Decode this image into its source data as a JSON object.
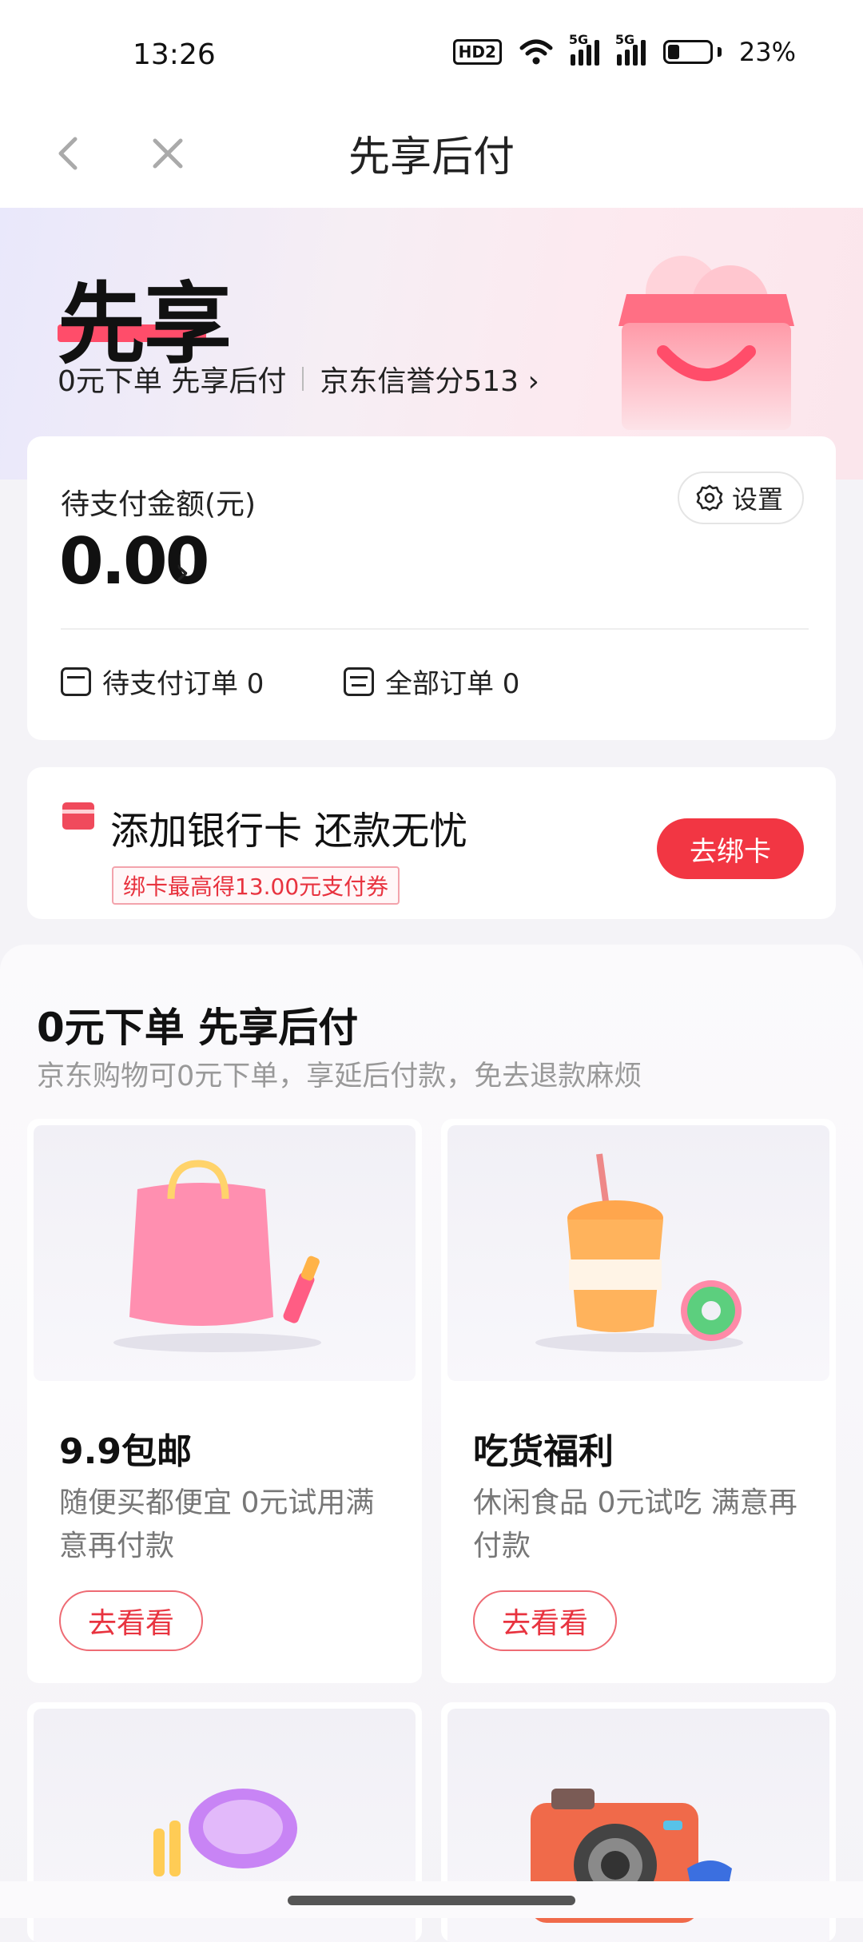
{
  "status_bar": {
    "time": "13:26",
    "hd_label": "HD2",
    "network_1": "5G",
    "network_2": "5G",
    "battery": "23%",
    "battery_level": 0.23
  },
  "nav": {
    "title": "先享后付"
  },
  "hero": {
    "title": "先享",
    "tagline": "0元下单 先享后付",
    "credit_score": "京东信誉分513",
    "credit_arrow": "›"
  },
  "pay_card": {
    "label": "待支付金额(元)",
    "amount": "0.00",
    "amount_arrow": "›",
    "settings_label": "设置",
    "pending_orders": "待支付订单 0",
    "all_orders": "全部订单 0"
  },
  "bank_card": {
    "title": "添加银行卡 还款无忧",
    "coupon": "绑卡最高得13.00元支付券",
    "button": "去绑卡"
  },
  "promo": {
    "title": "0元下单 先享后付",
    "desc": "京东购物可0元下单，享延后付款，免去退款麻烦",
    "tiles": [
      {
        "name": "9.9包邮",
        "desc": "随便买都便宜 0元试用满意再付款",
        "button": "去看看",
        "icon": "shopping-bag-icon"
      },
      {
        "name": "吃货福利",
        "desc": "休闲食品 0元试吃 满意再付款",
        "button": "去看看",
        "icon": "coffee-cup-icon"
      },
      {
        "icon": "cosmetics-icon"
      },
      {
        "icon": "camera-icon"
      }
    ]
  },
  "colors": {
    "accent": "#f23643",
    "hero_red": "#ff4d6a",
    "muted": "#999999"
  }
}
